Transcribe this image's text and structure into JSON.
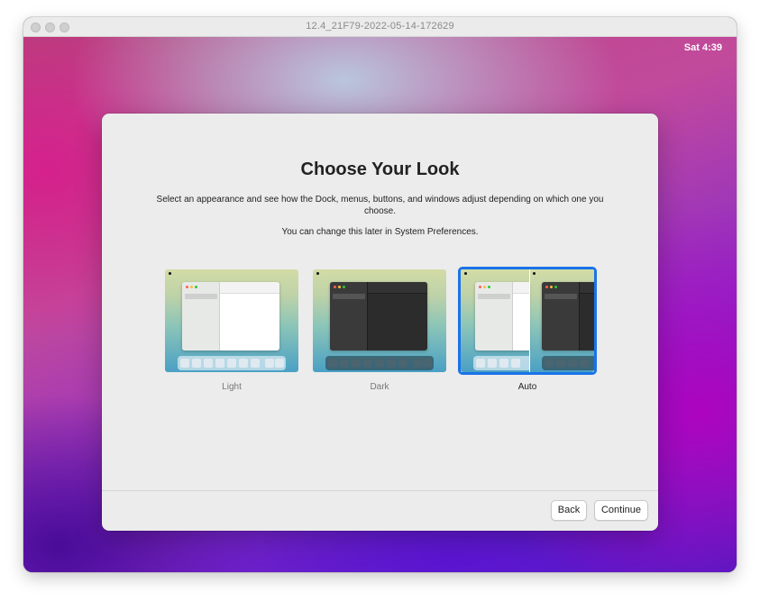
{
  "vm": {
    "title": "12.4_21F79-2022-05-14-172629"
  },
  "menubar": {
    "clock": "Sat 4:39"
  },
  "setup": {
    "title": "Choose Your Look",
    "description": "Select an appearance and see how the Dock, menus, buttons, and windows adjust depending on which one you choose.",
    "note": "You can change this later in System Preferences.",
    "options": [
      {
        "label": "Light",
        "selected": false
      },
      {
        "label": "Dark",
        "selected": false
      },
      {
        "label": "Auto",
        "selected": true
      }
    ],
    "buttons": {
      "back": "Back",
      "continue": "Continue"
    }
  },
  "colors": {
    "accent": "#1a73e8",
    "sheet_bg": "#ececec"
  }
}
